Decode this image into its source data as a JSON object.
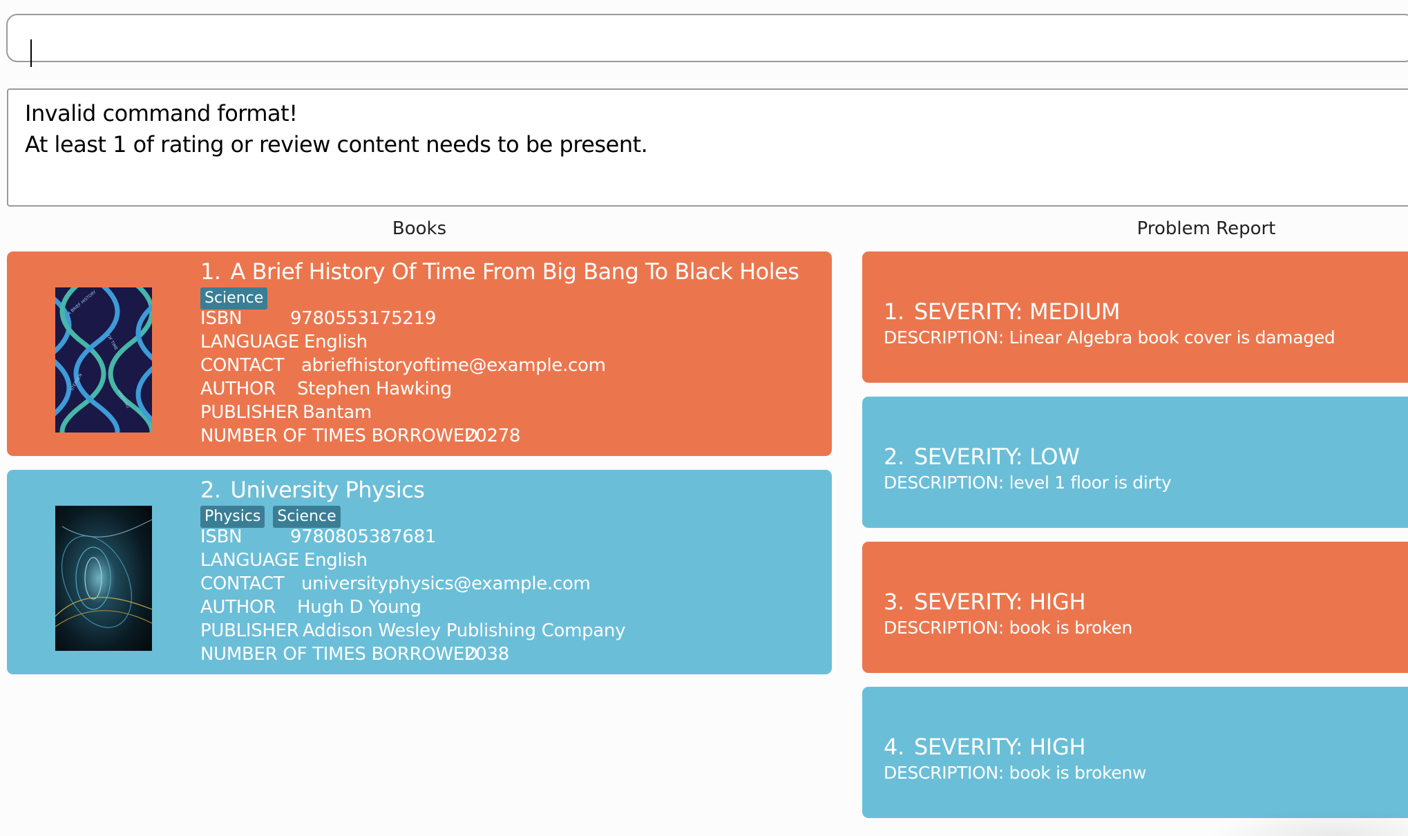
{
  "command": {
    "value": "",
    "placeholder": ""
  },
  "result": {
    "line1": "Invalid command format!",
    "line2": "At least 1 of rating or review content needs to be present."
  },
  "panels": {
    "books_title": "Books",
    "problems_title": "Problem Report"
  },
  "labels": {
    "isbn": "ISBN",
    "language": "LANGUAGE",
    "contact": "CONTACT",
    "author": "AUTHOR",
    "publisher": "PUBLISHER",
    "borrowed": "NUMBER OF TIMES BORROWED"
  },
  "books": [
    {
      "index": "1.",
      "title": "A Brief History Of Time From Big Bang To Black Holes",
      "tags": [
        "Science"
      ],
      "isbn": "9780553175219",
      "language": "English",
      "contact": "abriefhistoryoftime@example.com",
      "author": "Stephen Hawking",
      "publisher": "Bantam",
      "borrowed": "20278",
      "color": "#eb764e"
    },
    {
      "index": "2.",
      "title": "University Physics",
      "tags": [
        "Physics",
        "Science"
      ],
      "isbn": "9780805387681",
      "language": "English",
      "contact": "universityphysics@example.com",
      "author": "Hugh D Young",
      "publisher": "Addison Wesley Publishing Company",
      "borrowed": "2038",
      "color": "#6bbed8"
    }
  ],
  "problems": [
    {
      "index": "1.",
      "title": "SEVERITY: MEDIUM",
      "description": "DESCRIPTION: Linear Algebra book cover is damaged",
      "color": "#eb764e"
    },
    {
      "index": "2.",
      "title": "SEVERITY: LOW",
      "description": "DESCRIPTION: level 1 floor is dirty",
      "color": "#6bbed8"
    },
    {
      "index": "3.",
      "title": "SEVERITY: HIGH",
      "description": "DESCRIPTION: book is broken",
      "color": "#eb764e"
    },
    {
      "index": "4.",
      "title": "SEVERITY: HIGH",
      "description": "DESCRIPTION: book is brokenw",
      "color": "#6bbed8"
    }
  ],
  "colors": {
    "accent_orange": "#eb764e",
    "accent_blue": "#6bbed8",
    "tag": "#3a7e96"
  }
}
